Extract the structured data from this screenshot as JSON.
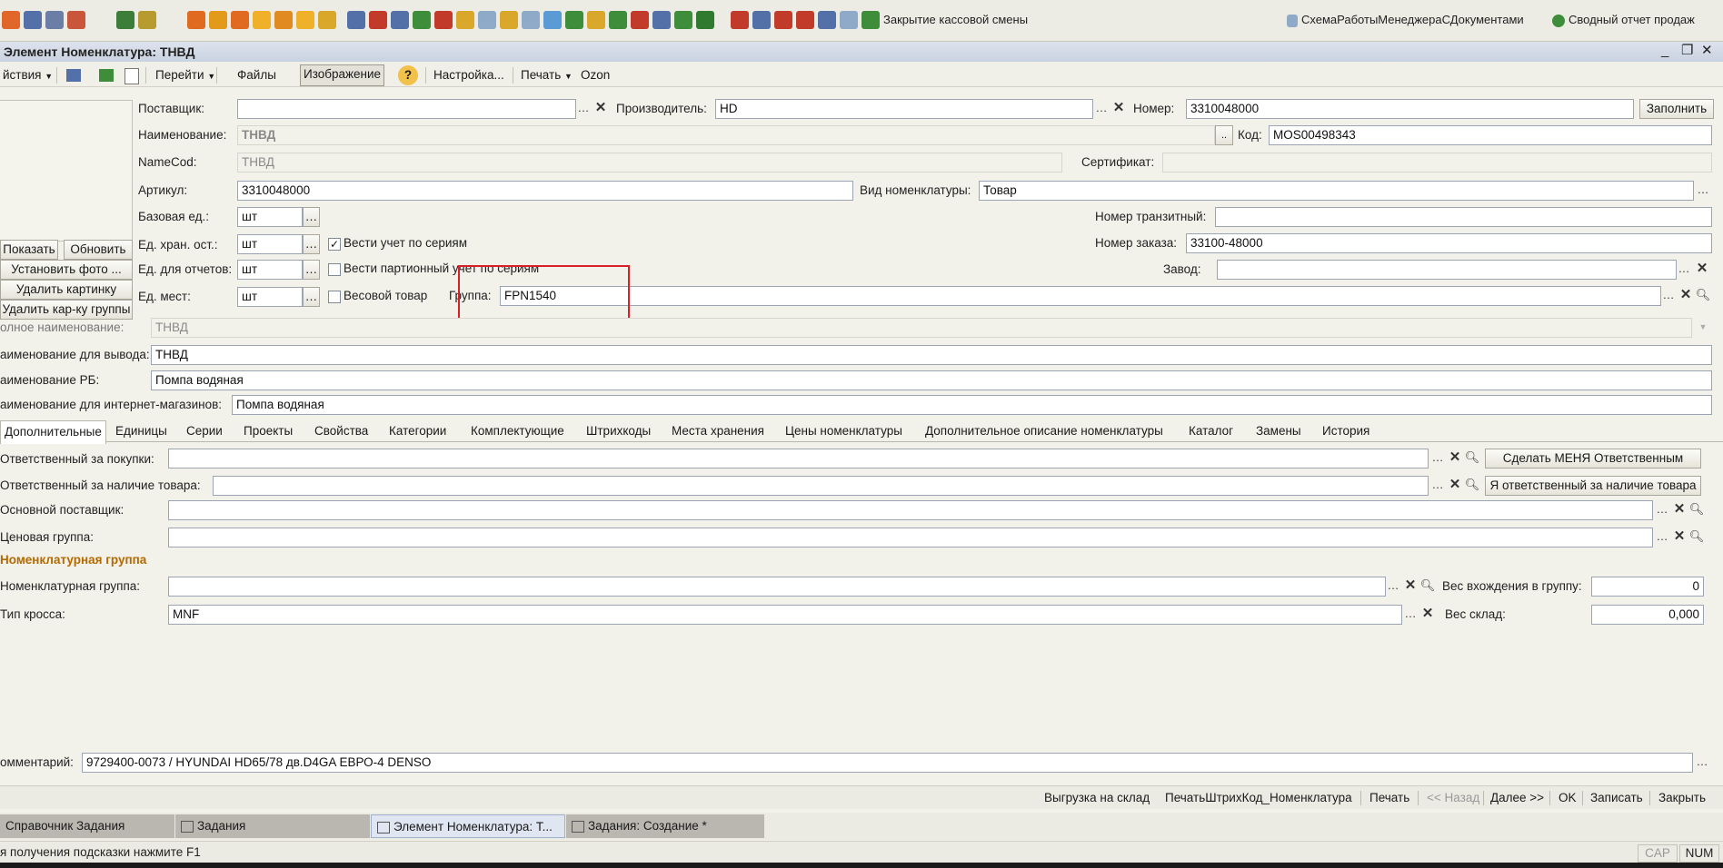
{
  "toolbar": {
    "item1": "Закрытие кассовой смены",
    "item2": "СхемаРаботыМенеджераСДокументами",
    "item3": "Сводный отчет продаж"
  },
  "window": {
    "title": "Элемент Номенклатура: ТНВД",
    "controls": [
      "_",
      "❐",
      "✕"
    ]
  },
  "cmdbar": {
    "actions": "йствия",
    "goto": "Перейти",
    "files": "Файлы",
    "image": "Изображение",
    "help": "?",
    "settings": "Настройка...",
    "print": "Печать",
    "ozon": "Ozon"
  },
  "image_panel": {
    "show": "Показать",
    "refresh": "Обновить",
    "set_photo": "Установить фото ...",
    "delete_image": "Удалить картинку",
    "delete_group_image": "Удалить кар-ку группы"
  },
  "form": {
    "supplier_label": "Поставщик:",
    "supplier_value": "",
    "manufacturer_label": "Производитель:",
    "manufacturer_value": "HD",
    "number_label": "Номер:",
    "number_value": "3310048000",
    "fill_button": "Заполнить",
    "name_label": "Наименование:",
    "name_value": "ТНВД",
    "code_label": "Код:",
    "code_value": "MOS00498343",
    "namecod_label": "NameCod:",
    "namecod_value": "ТНВД",
    "cert_label": "Сертификат:",
    "cert_value": "",
    "article_label": "Артикул:",
    "article_value": "3310048000",
    "kind_label": "Вид номенклатуры:",
    "kind_value": "Товар",
    "base_unit_label": "Базовая ед.:",
    "base_unit_value": "шт",
    "transit_label": "Номер транзитный:",
    "transit_value": "",
    "storage_unit_label": "Ед. хран. ост.:",
    "storage_unit_value": "шт",
    "series_check_label": "Вести учет по сериям",
    "series_checked": true,
    "order_number_label": "Номер заказа:",
    "order_number_value": "33100-48000",
    "report_unit_label": "Ед. для отчетов:",
    "report_unit_value": "шт",
    "batch_check_label": "Вести партионный учет по сериям",
    "batch_checked": false,
    "factory_label": "Завод:",
    "factory_value": "",
    "place_unit_label": "Ед. мест:",
    "place_unit_value": "шт",
    "weight_check_label": "Весовой товар",
    "weight_checked": false,
    "group_label": "Группа:",
    "group_value": "FPN1540",
    "full_name_label": "олное наименование:",
    "full_name_value": "ТНВД",
    "output_name_label": "аименование для вывода:",
    "output_name_value": "ТНВД",
    "rb_name_label": "аименование РБ:",
    "rb_name_value": "Помпа водяная",
    "shop_name_label": "аименование для интернет-магазинов:",
    "shop_name_value": "Помпа водяная"
  },
  "tabs": [
    "Дополнительные",
    "Единицы",
    "Серии",
    "Проекты",
    "Свойства",
    "Категории",
    "Комплектующие",
    "Штрихкоды",
    "Места хранения",
    "Цены номенклатуры",
    "Дополнительное описание номенклатуры",
    "Каталог",
    "Замены",
    "История"
  ],
  "tab_content": {
    "buyer_label": "Ответственный за покупки:",
    "buyer_value": "",
    "make_me_button": "Сделать МЕНЯ Ответственным",
    "stock_resp_label": "Ответственный за наличие товара:",
    "stock_resp_value": "",
    "i_am_resp_button": "Я ответственный за наличие товара",
    "main_supplier_label": "Основной поставщик:",
    "main_supplier_value": "",
    "price_group_label": "Ценовая группа:",
    "price_group_value": "",
    "section_title": "Номенклатурная группа",
    "nom_group_label": "Номенклатурная группа:",
    "nom_group_value": "",
    "group_weight_label": "Вес вхождения в группу:",
    "group_weight_value": "0",
    "cross_type_label": "Тип кросса:",
    "cross_type_value": "MNF",
    "stock_weight_label": "Вес склад:",
    "stock_weight_value": "0,000"
  },
  "comment": {
    "label": "омментарий:",
    "value": "9729400-0073 / HYUNDAI HD65/78 дв.D4GA ЕВРО-4 DENSO"
  },
  "bottom_actions": {
    "export": "Выгрузка на склад",
    "print_barcode": "ПечатьШтрихКод_Номенклатура",
    "print": "Печать",
    "back": "<< Назад",
    "next": "Далее >>",
    "ok": "OK",
    "save": "Записать",
    "close": "Закрыть"
  },
  "taskbar": [
    "Справочник Задания",
    "Задания",
    "Элемент Номенклатура: Т...",
    "Задания: Создание *"
  ],
  "status": {
    "hint": "я получения подсказки нажмите F1",
    "cap": "CAP",
    "num": "NUM"
  },
  "colors": {
    "highlight_box": "#d92027",
    "section_title": "#b36a00"
  }
}
